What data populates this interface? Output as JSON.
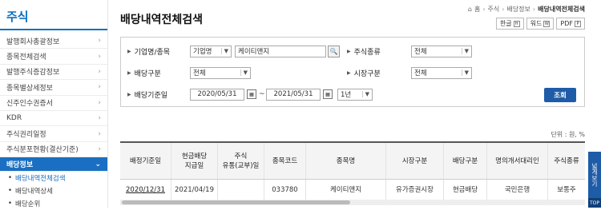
{
  "sidebar": {
    "title": "주식",
    "items": [
      {
        "label": "발행회사총괄정보"
      },
      {
        "label": "종목전체검색"
      },
      {
        "label": "발행주식증감정보"
      },
      {
        "label": "종목별상세정보"
      },
      {
        "label": "신주인수권증서"
      },
      {
        "label": "KDR"
      },
      {
        "label": "주식권리일정"
      },
      {
        "label": "주식분포현황(결산기준)"
      }
    ],
    "active": {
      "label": "배당정보"
    },
    "subitems": [
      {
        "label": "배당내역전체검색"
      },
      {
        "label": "배당내역상세"
      },
      {
        "label": "배당순위"
      }
    ]
  },
  "header": {
    "title": "배당내역전체검색",
    "breadcrumb": [
      "홈",
      "주식",
      "배당정보",
      "배당내역전체검색"
    ]
  },
  "doc_buttons": [
    {
      "label": "한글",
      "icon": "hwp-icon"
    },
    {
      "label": "워드",
      "icon": "word-icon"
    },
    {
      "label": "PDF",
      "icon": "pdf-icon"
    }
  ],
  "search": {
    "company_label": "기업명/종목",
    "company_type": "기업명",
    "company_value": "케이티앤지",
    "stock_type_label": "주식종류",
    "stock_type_value": "전체",
    "dividend_type_label": "배당구분",
    "dividend_type_value": "전체",
    "market_label": "시장구분",
    "market_value": "전체",
    "date_label": "배당기준일",
    "date_from": "2020/05/31",
    "date_to": "2021/05/31",
    "period": "1년",
    "submit_label": "조회"
  },
  "unit": "단위 : 원, %",
  "table": {
    "headers": [
      "배정기준일",
      "현금배당\n지급일",
      "주식\n유통(교부)일",
      "종목코드",
      "종목명",
      "시장구분",
      "배당구분",
      "명의개서대리인",
      "주식종류"
    ],
    "rows": [
      [
        "2020/12/31",
        "2021/04/19",
        "",
        "033780",
        "케이티앤지",
        "유가증권시장",
        "현금배당",
        "국민은행",
        "보통주"
      ]
    ]
  },
  "side_tab": {
    "label": "넓게보기",
    "top_label": "TOP"
  }
}
